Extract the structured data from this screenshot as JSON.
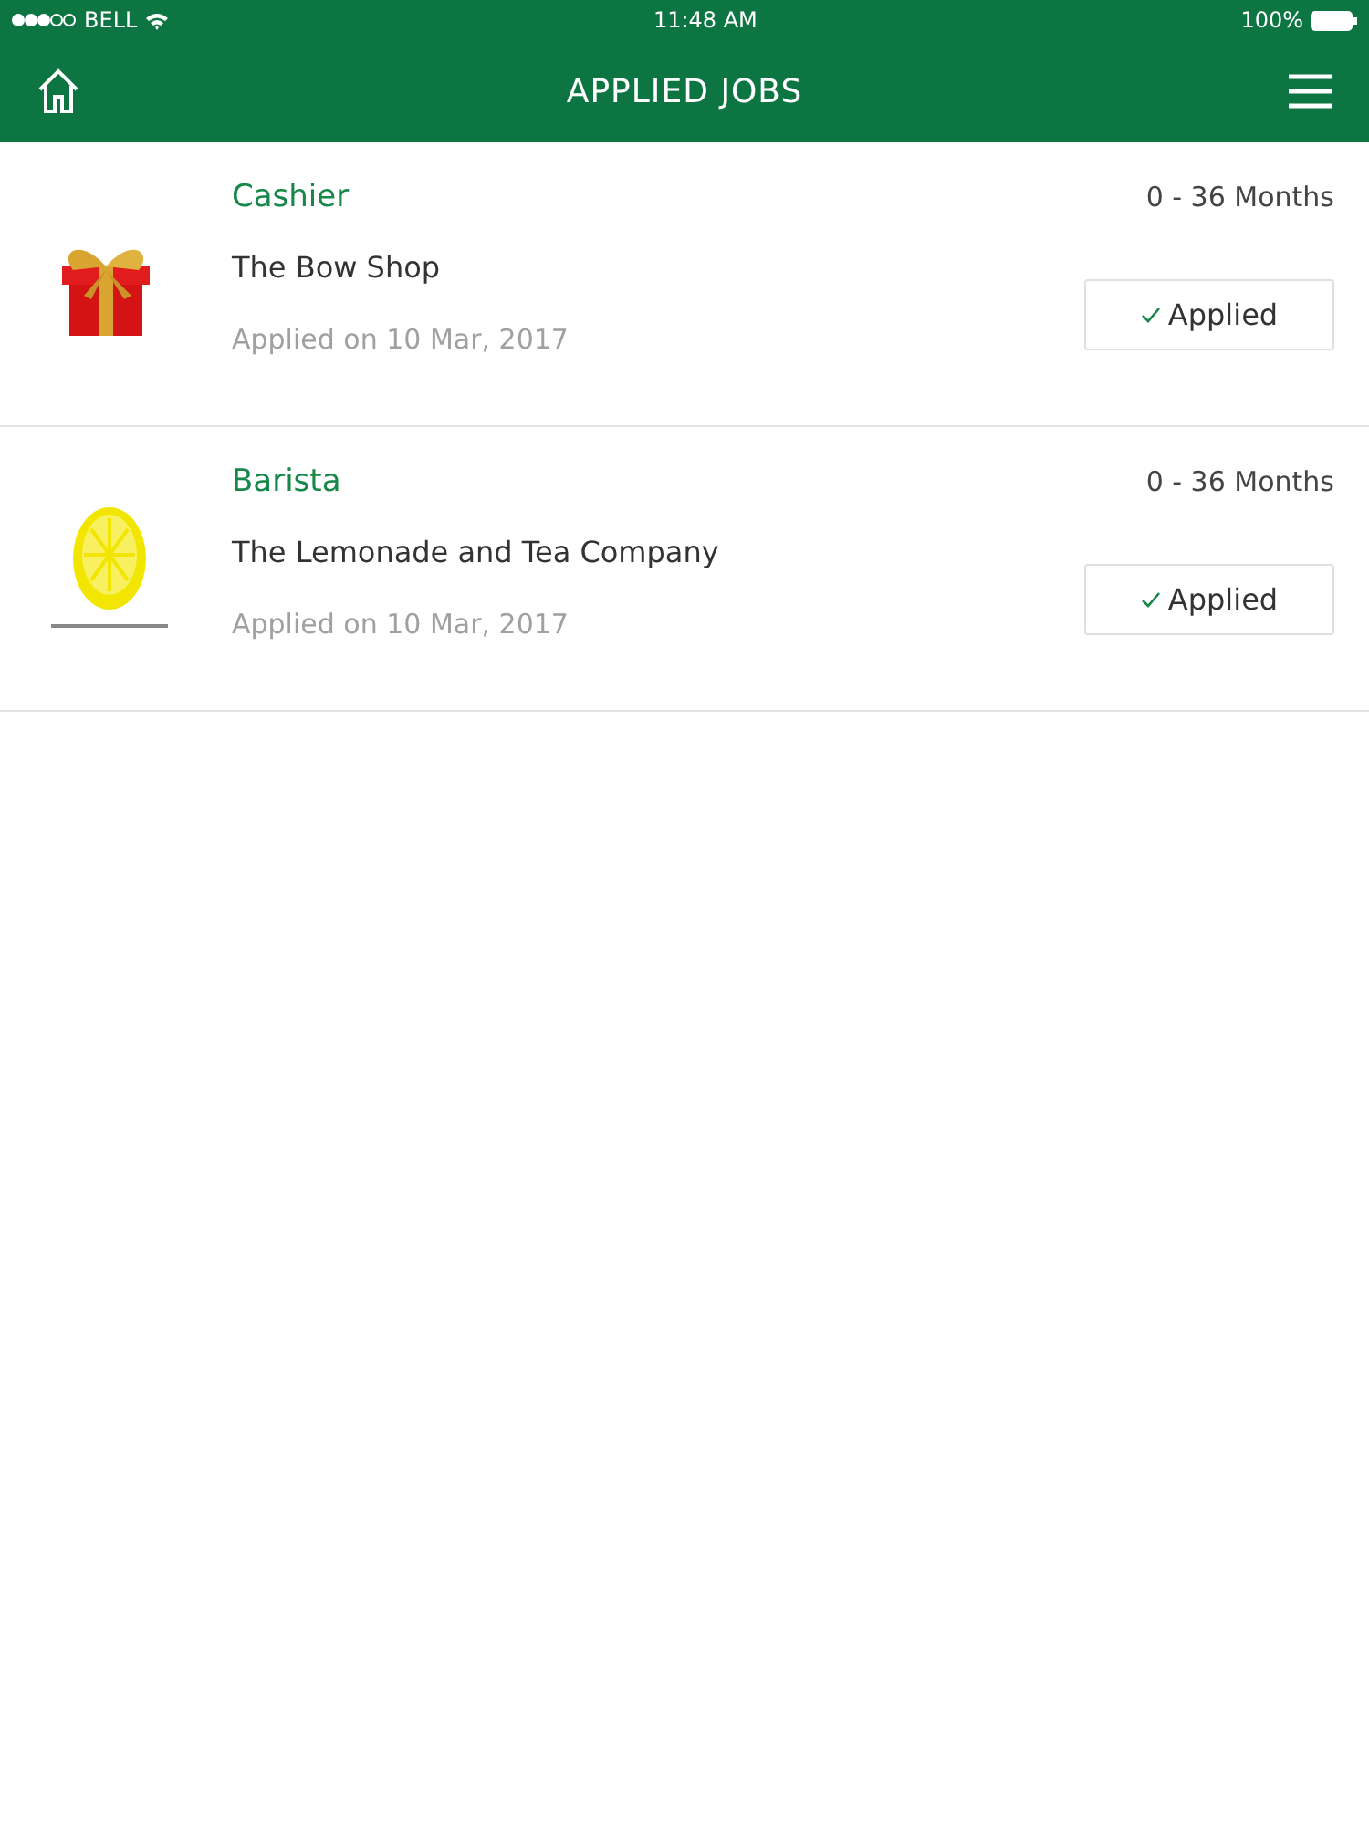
{
  "status_bar": {
    "carrier": "BELL",
    "time": "11:48 AM",
    "battery": "100%"
  },
  "header": {
    "title": "APPLIED JOBS"
  },
  "jobs": [
    {
      "title": "Cashier",
      "company": "The Bow Shop",
      "applied_on": "Applied on 10 Mar, 2017",
      "experience": "0 - 36 Months",
      "status": "Applied"
    },
    {
      "title": "Barista",
      "company": "The Lemonade and Tea Company",
      "applied_on": "Applied on 10 Mar, 2017",
      "experience": "0 - 36 Months",
      "status": "Applied"
    }
  ]
}
